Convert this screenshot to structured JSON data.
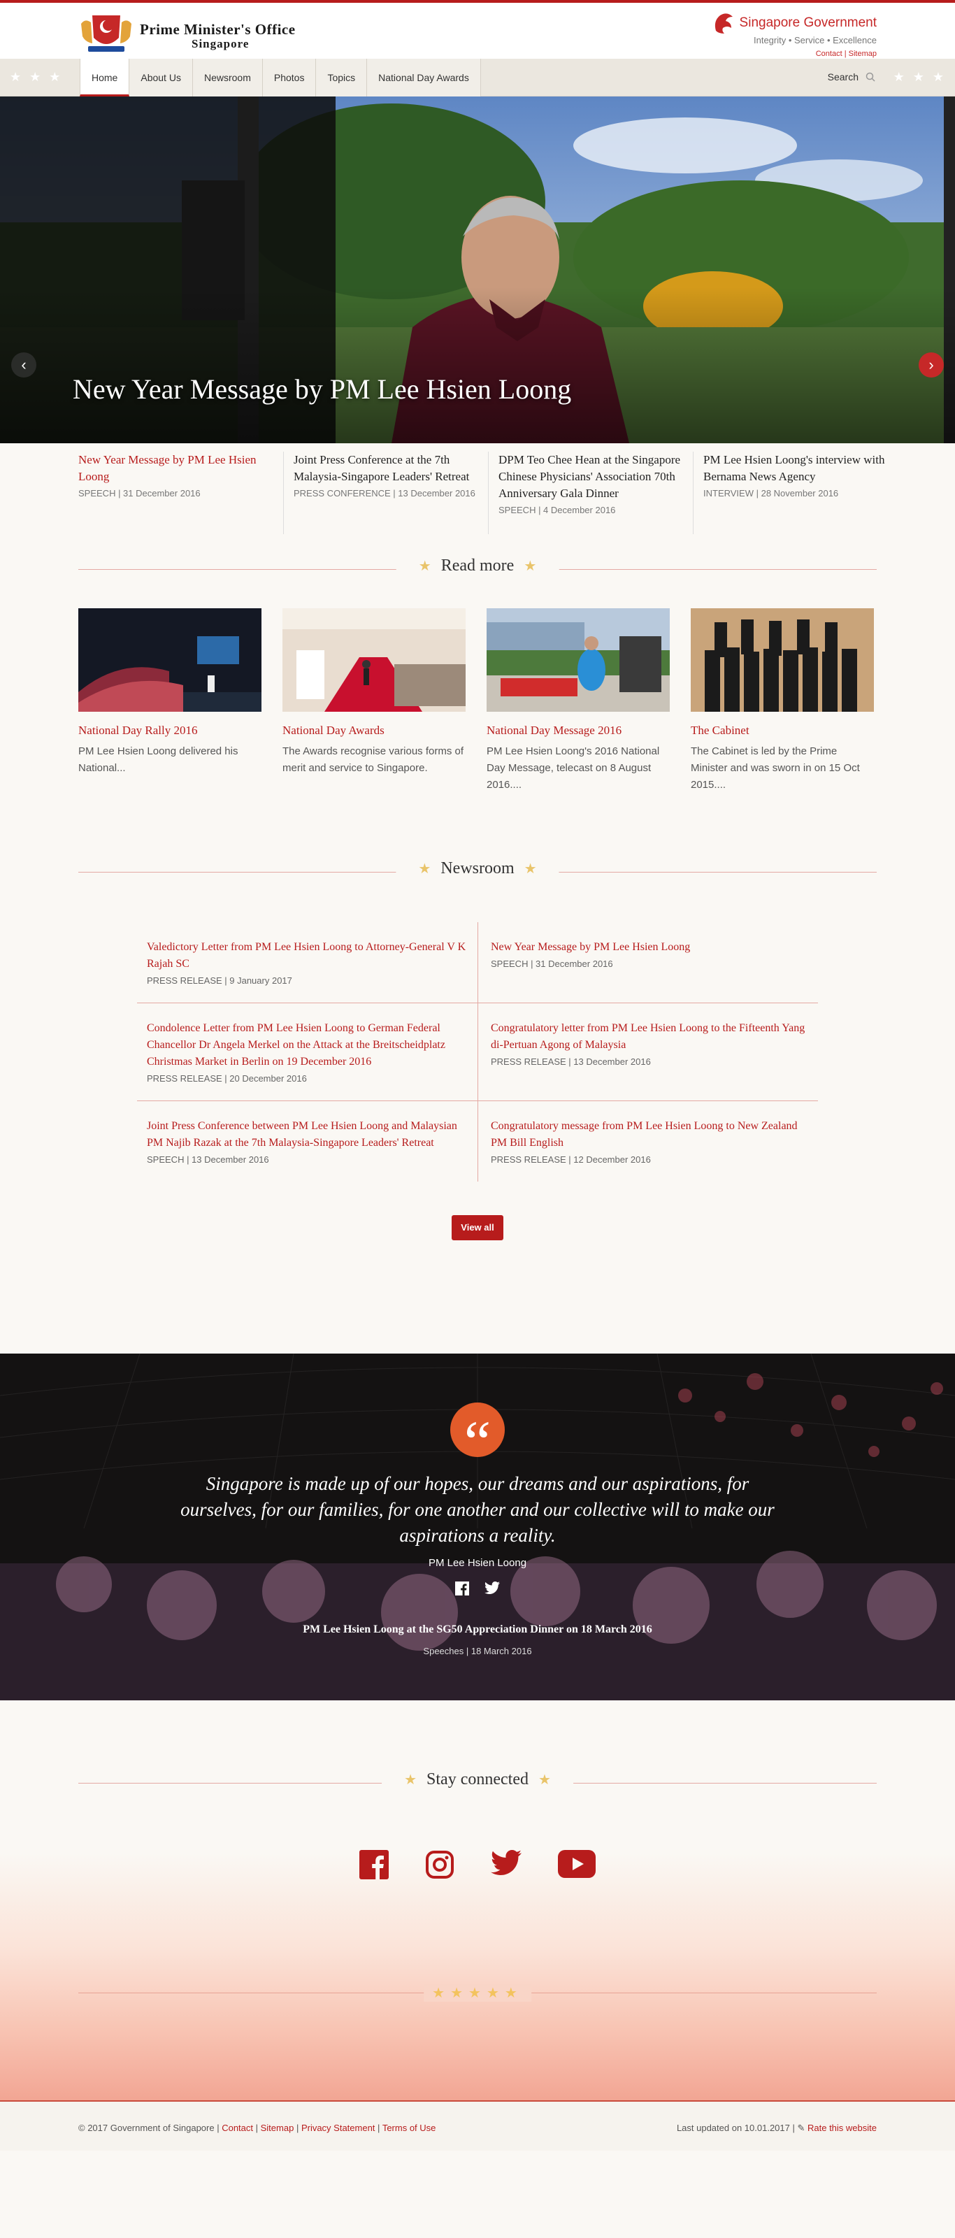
{
  "header": {
    "title_line1": "Prime Minister's Office",
    "title_line2": "Singapore",
    "gov_name": "Singapore Government",
    "gov_tagline": "Integrity • Service • Excellence",
    "contact": "Contact",
    "sitemap": "Sitemap",
    "brand_color": "#b71c1c"
  },
  "nav": {
    "items": [
      {
        "label": "Home"
      },
      {
        "label": "About Us"
      },
      {
        "label": "Newsroom"
      },
      {
        "label": "Photos"
      },
      {
        "label": "Topics"
      },
      {
        "label": "National Day Awards"
      }
    ],
    "search_label": "Search"
  },
  "hero": {
    "caption": "New Year Message by PM Lee Hsien Loong",
    "tabs": [
      {
        "title": "New Year Message by PM Lee Hsien Loong",
        "meta": "SPEECH | 31 December 2016"
      },
      {
        "title": "Joint Press Conference at the 7th Malaysia-Singapore Leaders' Retreat",
        "meta": "PRESS CONFERENCE | 13 December 2016"
      },
      {
        "title": "DPM Teo Chee Hean at the Singapore Chinese Physicians' Association 70th Anniversary Gala Dinner",
        "meta": "SPEECH | 4 December 2016"
      },
      {
        "title": "PM Lee Hsien Loong's interview with Bernama News Agency",
        "meta": "INTERVIEW | 28 November 2016"
      }
    ]
  },
  "readmore": {
    "heading": "Read more",
    "cards": [
      {
        "title": "National Day Rally 2016",
        "desc": "PM Lee Hsien Loong delivered his National..."
      },
      {
        "title": "National Day Awards",
        "desc": "The Awards recognise various forms of merit and service to Singapore."
      },
      {
        "title": "National Day Message 2016",
        "desc": "PM Lee Hsien Loong's 2016 National Day Message, telecast on 8 August 2016...."
      },
      {
        "title": "The Cabinet",
        "desc": "The Cabinet is led by the Prime Minister and was sworn in on 15 Oct 2015...."
      }
    ]
  },
  "newsroom": {
    "heading": "Newsroom",
    "items": [
      {
        "title": "Valedictory Letter from PM Lee Hsien Loong to Attorney-General V K Rajah SC",
        "meta": "PRESS RELEASE | 9 January 2017"
      },
      {
        "title": "New Year Message by PM Lee Hsien Loong",
        "meta": "SPEECH | 31 December 2016"
      },
      {
        "title": "Condolence Letter from PM Lee Hsien Loong to German Federal Chancellor Dr Angela Merkel on the Attack at the Breitscheidplatz Christmas Market in Berlin on 19 December 2016",
        "meta": "PRESS RELEASE | 20 December 2016"
      },
      {
        "title": "Congratulatory letter from PM Lee Hsien Loong to the Fifteenth Yang di-Pertuan Agong of Malaysia",
        "meta": "PRESS RELEASE | 13 December 2016"
      },
      {
        "title": "Joint Press Conference between PM Lee Hsien Loong and Malaysian PM Najib Razak at the 7th Malaysia-Singapore Leaders' Retreat",
        "meta": "SPEECH | 13 December 2016"
      },
      {
        "title": "Congratulatory message from PM Lee Hsien Loong to New Zealand PM Bill English",
        "meta": "PRESS RELEASE | 12 December 2016"
      }
    ],
    "view_all": "View all"
  },
  "quote": {
    "mark": "“",
    "text": "Singapore is made up of our hopes, our dreams and our aspirations, for ourselves, for our families, for one another and our collective will to make our aspirations a reality.",
    "author": "PM Lee Hsien Loong",
    "event": "PM Lee Hsien Loong at the SG50 Appreciation Dinner on 18 March 2016",
    "meta": "Speeches | 18 March 2016",
    "accent": "#e25b2a"
  },
  "stay": {
    "heading": "Stay connected",
    "icons": [
      "facebook-icon",
      "instagram-icon",
      "twitter-icon",
      "youtube-icon"
    ]
  },
  "footer": {
    "copyright": "© 2017 Government of Singapore | ",
    "links": [
      "Contact",
      "Sitemap",
      "Privacy Statement",
      "Terms of Use"
    ],
    "updated": "Last updated on 10.01.2017 | ",
    "rate": "Rate this website"
  }
}
